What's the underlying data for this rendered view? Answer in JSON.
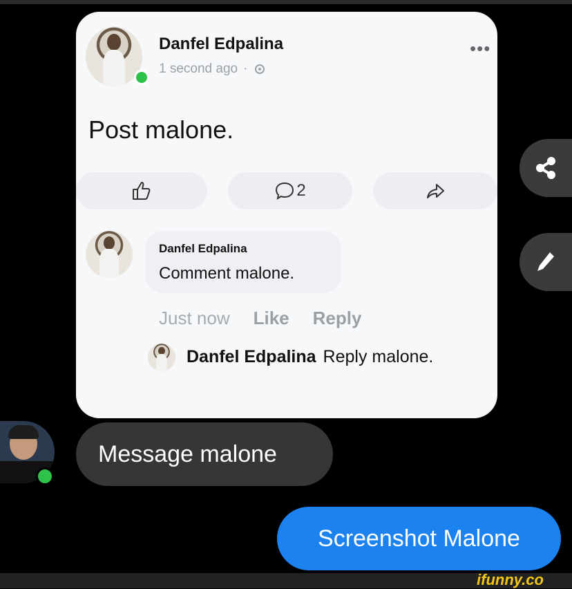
{
  "post": {
    "author": "Danfel Edpalina",
    "timestamp": "1 second ago",
    "separator": "·",
    "privacy_icon": "gear-icon",
    "more_icon": "more-dots-icon",
    "text": "Post malone.",
    "actions": {
      "like_icon": "thumbs-up-icon",
      "comment_icon": "comment-icon",
      "comment_count": "2",
      "share_icon": "share-arrow-icon"
    }
  },
  "comment": {
    "author": "Danfel Edpalina",
    "text": "Comment malone.",
    "time": "Just now",
    "like_label": "Like",
    "reply_label": "Reply"
  },
  "reply": {
    "author": "Danfel Edpalina",
    "text": "Reply malone."
  },
  "side_buttons": [
    "share-icon",
    "edit-pencil-icon"
  ],
  "messages": {
    "incoming": "Message malone",
    "outgoing": "Screenshot Malone"
  },
  "colors": {
    "background": "#000000",
    "card": "#f7f8fa",
    "incoming_bubble": "#353638",
    "outgoing_bubble": "#1b82ef",
    "online": "#2ec24a",
    "watermark": "#f2c619"
  },
  "watermark": "ifunny.co"
}
